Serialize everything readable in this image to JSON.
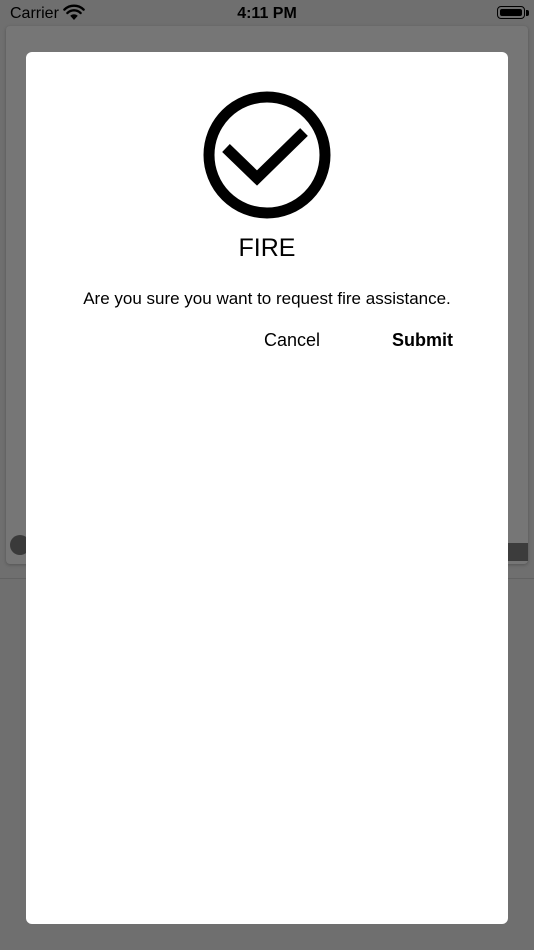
{
  "status_bar": {
    "carrier": "Carrier",
    "time": "4:11 PM",
    "wifi_icon": "wifi-icon",
    "battery_icon": "battery-icon"
  },
  "dialog": {
    "icon": "check-circle-icon",
    "title": "FIRE",
    "message": "Are you sure you want to request fire assistance.",
    "cancel_label": "Cancel",
    "submit_label": "Submit"
  },
  "colors": {
    "overlay": "#6f6f6f",
    "dialog_background": "#ffffff",
    "text": "#000000"
  }
}
